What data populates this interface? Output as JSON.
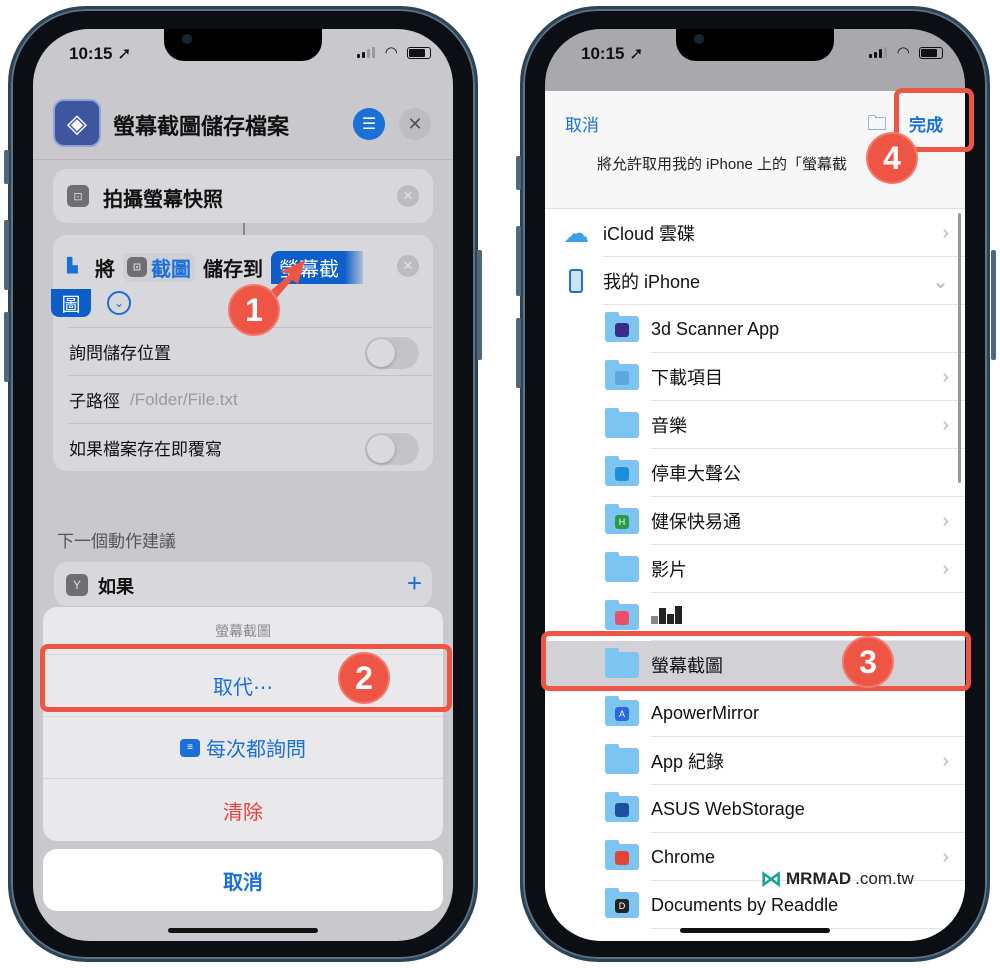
{
  "left_phone": {
    "status": {
      "time": "10:15",
      "location_icon": "location-arrow-icon"
    },
    "header": {
      "title": "螢幕截圖儲存檔案",
      "app_icon": "shortcuts-layers-icon",
      "settings_icon": "sliders-icon",
      "close_icon": "close-icon"
    },
    "actions": {
      "screenshot_action": {
        "label": "拍攝螢幕快照"
      },
      "save_action": {
        "word_will": "將",
        "input_var": "截圖",
        "word_save_to": "儲存到",
        "dest_var_part1": "螢幕截",
        "dest_var_part2": "圖"
      },
      "options": [
        {
          "label": "詢問儲存位置",
          "type": "toggle",
          "on": false
        },
        {
          "label": "子路徑",
          "type": "text",
          "placeholder": "/Folder/File.txt"
        },
        {
          "label": "如果檔案存在即覆寫",
          "type": "toggle",
          "on": false
        }
      ]
    },
    "suggestions": {
      "label": "下一個動作建議",
      "items": [
        {
          "label": "如果",
          "icon": "branch-icon"
        }
      ]
    },
    "action_sheet": {
      "title": "螢幕截圖",
      "replace": "取代⋯",
      "ask_each_time": "每次都詢問",
      "clear": "清除",
      "cancel": "取消"
    }
  },
  "right_phone": {
    "status": {
      "time": "10:15"
    },
    "picker": {
      "cancel": "取消",
      "done": "完成",
      "message": "將允許取用我的 iPhone 上的「螢幕截",
      "locations": [
        {
          "name": "iCloud 雲碟",
          "icon": "icloud-icon",
          "chevron": "right"
        },
        {
          "name": "我的 iPhone",
          "icon": "iphone-icon",
          "chevron": "down"
        }
      ],
      "folders": [
        {
          "name": "3d Scanner App",
          "badge": "app-badge",
          "badge_color": "#3a2a8a",
          "chevron": false
        },
        {
          "name": "下載項目",
          "badge": "download-badge",
          "badge_color": "",
          "chevron": true
        },
        {
          "name": "音樂",
          "badge": "",
          "badge_color": "",
          "chevron": true
        },
        {
          "name": "停車大聲公",
          "badge": "pin-badge",
          "badge_color": "#1a8fd8",
          "chevron": false
        },
        {
          "name": "健保快易通",
          "badge": "H",
          "badge_color": "#2a9a4a",
          "chevron": true
        },
        {
          "name": "影片",
          "badge": "",
          "badge_color": "",
          "chevron": true
        },
        {
          "name": "",
          "badge": "camera-badge",
          "badge_color": "#e94f6a",
          "chevron": false,
          "pixelated": true
        },
        {
          "name": "螢幕截圖",
          "badge": "",
          "badge_color": "",
          "chevron": false,
          "selected": true
        },
        {
          "name": "ApowerMirror",
          "badge": "A",
          "badge_color": "#2a6ae0",
          "chevron": false
        },
        {
          "name": "App 紀錄",
          "badge": "",
          "badge_color": "",
          "chevron": true
        },
        {
          "name": "ASUS WebStorage",
          "badge": "asus-badge",
          "badge_color": "#1c4fa0",
          "chevron": false
        },
        {
          "name": "Chrome",
          "badge": "chrome-badge",
          "badge_color": "#e0443a",
          "chevron": true
        },
        {
          "name": "Documents by Readdle",
          "badge": "D",
          "badge_color": "#222",
          "chevron": false
        }
      ]
    }
  },
  "annotations": {
    "step1": "1",
    "step2": "2",
    "step3": "3",
    "step4": "4",
    "color": "#ef5545"
  },
  "watermark": {
    "brand": "MRMAD",
    "domain": ".com.tw"
  }
}
